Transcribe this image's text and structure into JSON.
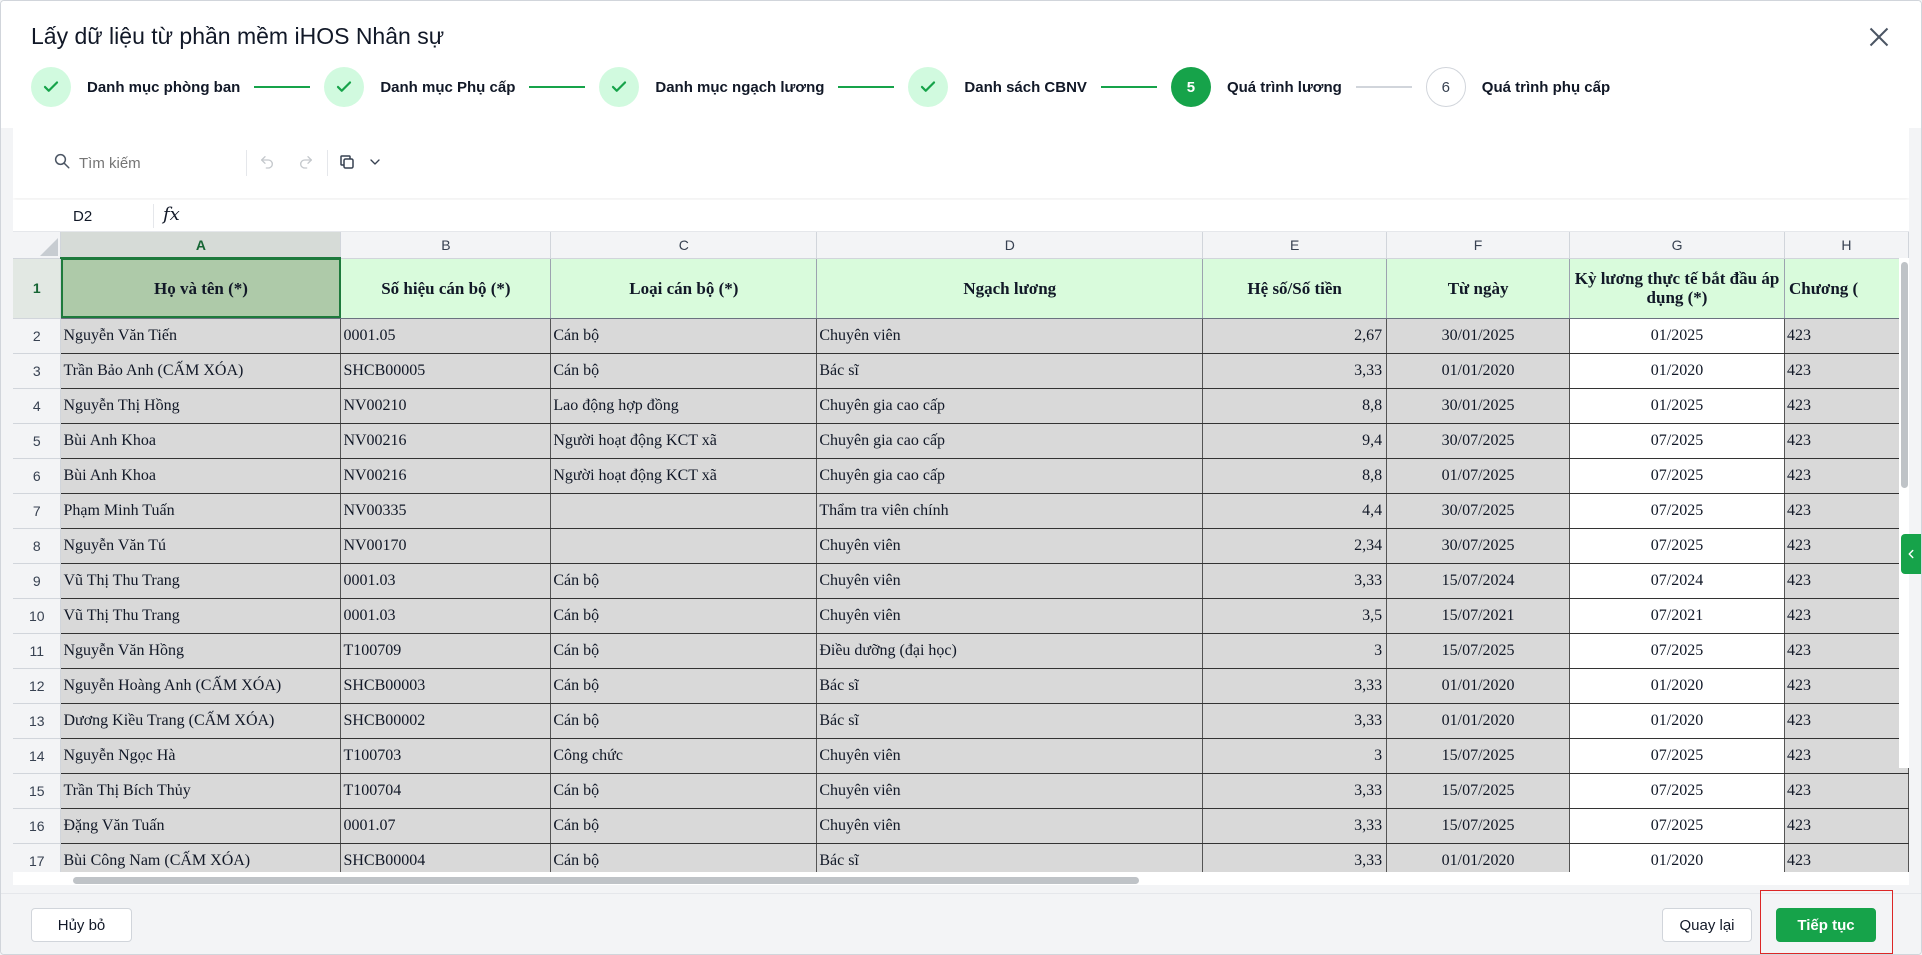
{
  "dialog": {
    "title": "Lấy dữ liệu từ phần mềm iHOS Nhân sự"
  },
  "stepper": {
    "steps": [
      {
        "label": "Danh mục phòng ban",
        "state": "done"
      },
      {
        "label": "Danh mục Phụ cấp",
        "state": "done"
      },
      {
        "label": "Danh mục ngạch lương",
        "state": "done"
      },
      {
        "label": "Danh sách CBNV",
        "state": "done"
      },
      {
        "label": "Quá trình lương",
        "state": "active",
        "number": "5"
      },
      {
        "label": "Quá trình phụ cấp",
        "state": "todo",
        "number": "6"
      }
    ]
  },
  "toolbar": {
    "search_placeholder": "Tìm kiếm"
  },
  "formula": {
    "cell_ref": "D2",
    "fx": "fx"
  },
  "grid": {
    "columns": [
      "A",
      "B",
      "C",
      "D",
      "E",
      "F",
      "G",
      "H"
    ],
    "header_row": {
      "row_num": "1",
      "cells": [
        "Họ và tên (*)",
        "Số hiệu cán bộ (*)",
        "Loại cán bộ (*)",
        "Ngạch lương",
        "Hệ số/Số tiền",
        "Từ ngày",
        "Kỳ lương thực tế bắt đầu áp dụng (*)",
        "Chương ("
      ]
    },
    "rows": [
      {
        "n": "2",
        "cells": [
          "Nguyễn Văn Tiến",
          "0001.05",
          "Cán bộ",
          "Chuyên viên",
          "2,67",
          "30/01/2025",
          "01/2025",
          "423"
        ]
      },
      {
        "n": "3",
        "cells": [
          "Trần Bảo Anh (CẤM XÓA)",
          "SHCB00005",
          "Cán bộ",
          "Bác sĩ",
          "3,33",
          "01/01/2020",
          "01/2020",
          "423"
        ]
      },
      {
        "n": "4",
        "cells": [
          "Nguyễn Thị Hồng",
          "NV00210",
          "Lao động hợp đồng",
          "Chuyên gia cao cấp",
          "8,8",
          "30/01/2025",
          "01/2025",
          "423"
        ]
      },
      {
        "n": "5",
        "cells": [
          "Bùi Anh Khoa",
          "NV00216",
          "Người hoạt động KCT xã",
          "Chuyên gia cao cấp",
          "9,4",
          "30/07/2025",
          "07/2025",
          "423"
        ]
      },
      {
        "n": "6",
        "cells": [
          "Bùi Anh Khoa",
          "NV00216",
          "Người hoạt động KCT xã",
          "Chuyên gia cao cấp",
          "8,8",
          "01/07/2025",
          "07/2025",
          "423"
        ]
      },
      {
        "n": "7",
        "cells": [
          "Phạm Minh Tuấn",
          "NV00335",
          "",
          "Thẩm tra viên chính",
          "4,4",
          "30/07/2025",
          "07/2025",
          "423"
        ]
      },
      {
        "n": "8",
        "cells": [
          "Nguyễn Văn Tú",
          "NV00170",
          "",
          "Chuyên viên",
          "2,34",
          "30/07/2025",
          "07/2025",
          "423"
        ]
      },
      {
        "n": "9",
        "cells": [
          "Vũ Thị Thu Trang",
          "0001.03",
          "Cán bộ",
          "Chuyên viên",
          "3,33",
          "15/07/2024",
          "07/2024",
          "423"
        ]
      },
      {
        "n": "10",
        "cells": [
          "Vũ Thị Thu Trang",
          "0001.03",
          "Cán bộ",
          "Chuyên viên",
          "3,5",
          "15/07/2021",
          "07/2021",
          "423"
        ]
      },
      {
        "n": "11",
        "cells": [
          "Nguyễn Văn Hồng",
          "T100709",
          "Cán bộ",
          "Điều dưỡng (đại học)",
          "3",
          "15/07/2025",
          "07/2025",
          "423"
        ]
      },
      {
        "n": "12",
        "cells": [
          "Nguyễn Hoàng Anh (CẤM XÓA)",
          "SHCB00003",
          "Cán bộ",
          "Bác sĩ",
          "3,33",
          "01/01/2020",
          "01/2020",
          "423"
        ]
      },
      {
        "n": "13",
        "cells": [
          "Dương Kiều Trang (CẤM XÓA)",
          "SHCB00002",
          "Cán bộ",
          "Bác sĩ",
          "3,33",
          "01/01/2020",
          "01/2020",
          "423"
        ]
      },
      {
        "n": "14",
        "cells": [
          "Nguyễn Ngọc Hà",
          "T100703",
          "Công chức",
          "Chuyên viên",
          "3",
          "15/07/2025",
          "07/2025",
          "423"
        ]
      },
      {
        "n": "15",
        "cells": [
          "Trần Thị Bích Thủy",
          "T100704",
          "Cán bộ",
          "Chuyên viên",
          "3,33",
          "15/07/2025",
          "07/2025",
          "423"
        ]
      },
      {
        "n": "16",
        "cells": [
          "Đặng Văn Tuấn",
          "0001.07",
          "Cán bộ",
          "Chuyên viên",
          "3,33",
          "15/07/2025",
          "07/2025",
          "423"
        ]
      },
      {
        "n": "17",
        "cells": [
          "Bùi Công Nam (CẤM XÓA)",
          "SHCB00004",
          "Cán bộ",
          "Bác sĩ",
          "3,33",
          "01/01/2020",
          "01/2020",
          "423"
        ]
      }
    ]
  },
  "footer": {
    "cancel_label": "Hủy bỏ",
    "back_label": "Quay lại",
    "next_label": "Tiếp tục"
  },
  "colors": {
    "accent": "#16a34a",
    "header_fill": "#d9fbdc",
    "cell_fill": "#d9d9d9"
  }
}
